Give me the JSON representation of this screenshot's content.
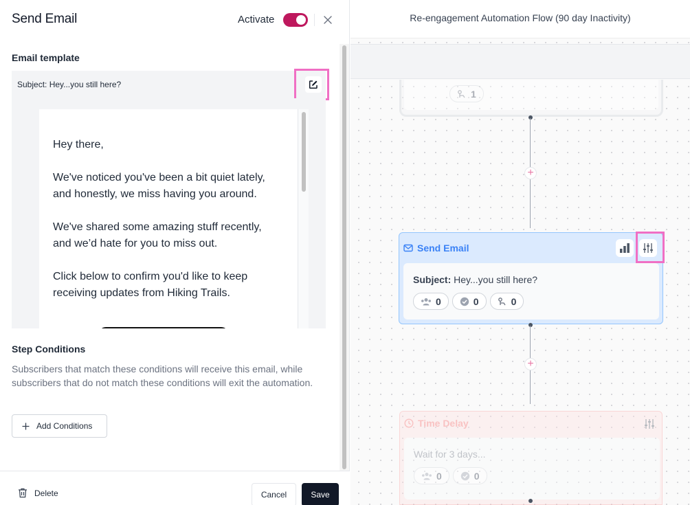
{
  "panel": {
    "title": "Send Email",
    "activate_label": "Activate",
    "activate_on": true,
    "accent_color": "#be185d",
    "email_template_label": "Email template",
    "subject": "Subject: Hey...you still here?",
    "email_body": {
      "greeting": "Hey there,",
      "p1_line1": "We've noticed you've been a bit quiet lately,",
      "p1_line2": "and honestly, we miss having you around.",
      "p2_line1": "We've shared some amazing stuff recently,",
      "p2_line2": "and we’d hate for you to miss out.",
      "p3_line1": "Click below to confirm you'd like to keep",
      "p3_line2": "receiving updates from Hiking Trails."
    },
    "step_conditions_label": "Step Conditions",
    "step_conditions_desc": "Subscribers that match these conditions will receive this email, while subscribers that do not match these conditions will exit the automation.",
    "add_conditions_label": "Add Conditions",
    "delete_label": "Delete",
    "cancel_label": "Cancel",
    "save_label": "Save"
  },
  "canvas": {
    "title": "Re-engagement Automation Flow (90 day Inactivity)",
    "top_node": {
      "exit_count": "1"
    },
    "email_node": {
      "title": "Send Email",
      "subject_label": "Subject:",
      "subject_value": "Hey...you still here?",
      "subscribers_count": "0",
      "completed_count": "0",
      "exited_count": "0"
    },
    "delay_node": {
      "title": "Time Delay",
      "wait_text": "Wait for 3 days...",
      "subscribers_count": "0",
      "completed_count": "0"
    }
  }
}
